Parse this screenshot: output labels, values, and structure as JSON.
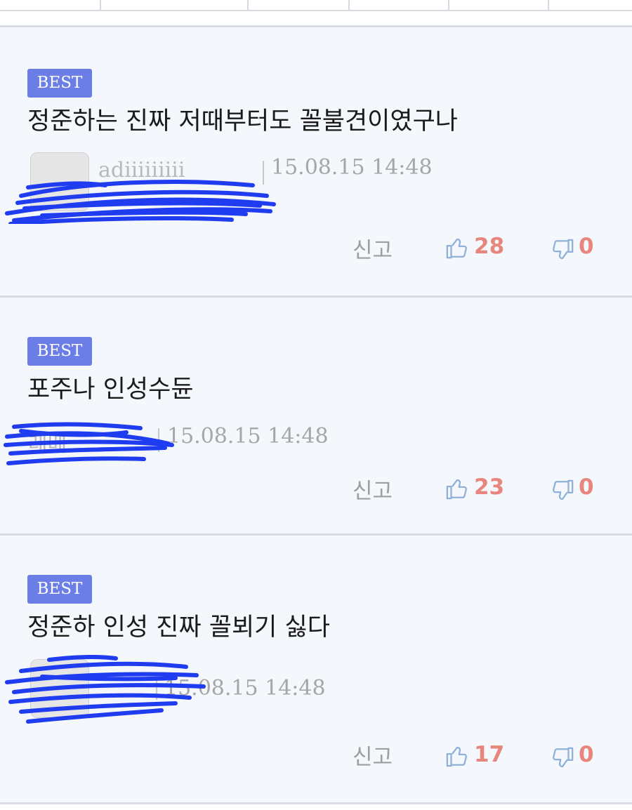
{
  "comments": [
    {
      "badge": "BEST",
      "text": "정준하는 진짜 저때부터도 꼴불견이였구나",
      "date": "15.08.15 14:48",
      "report_label": "신고",
      "likes": "28",
      "dislikes": "0"
    },
    {
      "badge": "BEST",
      "text": "포주나 인성수듄",
      "date": "15.08.15 14:48",
      "report_label": "신고",
      "likes": "23",
      "dislikes": "0"
    },
    {
      "badge": "BEST",
      "text": "정준하 인성 진짜 꼴뵈기 싫다",
      "date": "15.08.15 14:48",
      "report_label": "신고",
      "likes": "17",
      "dislikes": "0"
    }
  ],
  "icons": {
    "like": "thumbs-up-icon",
    "dislike": "thumbs-down-icon"
  },
  "colors": {
    "badge_bg": "#6b7ee8",
    "count_color": "#e8867e",
    "icon_color": "#8fb0d8",
    "redaction": "#1f3cf0"
  }
}
